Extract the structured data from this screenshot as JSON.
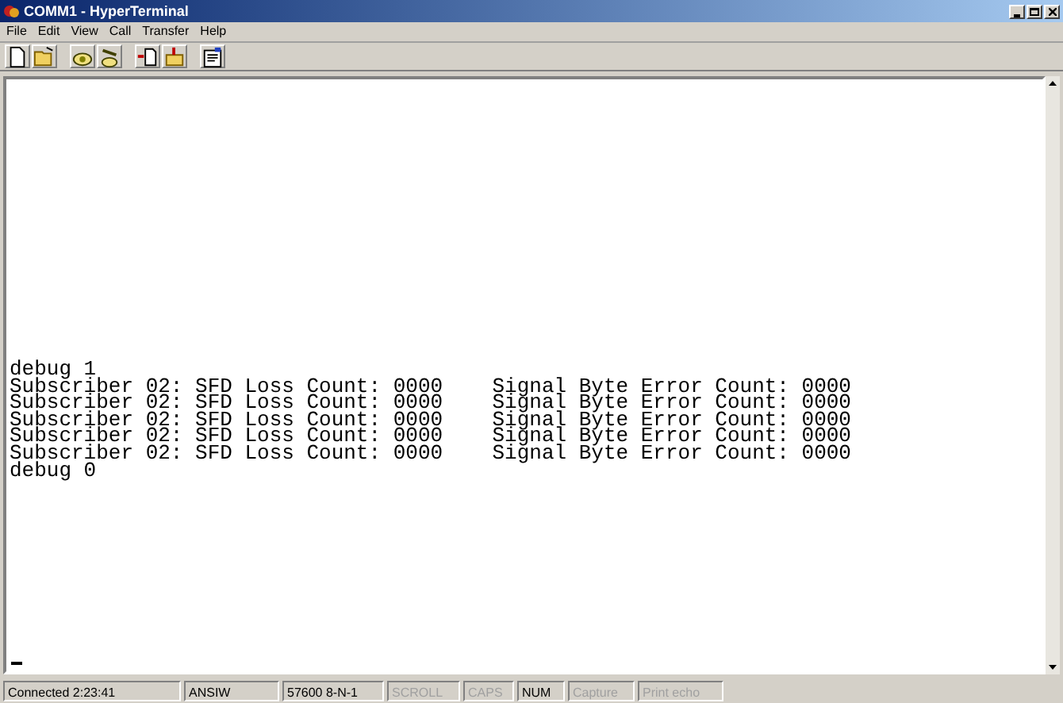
{
  "window": {
    "title": "COMM1 - HyperTerminal"
  },
  "menu": [
    "File",
    "Edit",
    "View",
    "Call",
    "Transfer",
    "Help"
  ],
  "toolbar": [
    {
      "kind": "new"
    },
    {
      "kind": "open"
    },
    {
      "kind": "sep"
    },
    {
      "kind": "call"
    },
    {
      "kind": "hangup"
    },
    {
      "kind": "sep"
    },
    {
      "kind": "send"
    },
    {
      "kind": "receive"
    },
    {
      "kind": "sep"
    },
    {
      "kind": "properties"
    }
  ],
  "terminal": {
    "lines": [
      "debug 1",
      "Subscriber 02: SFD Loss Count: 0000    Signal Byte Error Count: 0000",
      "Subscriber 02: SFD Loss Count: 0000    Signal Byte Error Count: 0000",
      "Subscriber 02: SFD Loss Count: 0000    Signal Byte Error Count: 0000",
      "Subscriber 02: SFD Loss Count: 0000    Signal Byte Error Count: 0000",
      "Subscriber 02: SFD Loss Count: 0000    Signal Byte Error Count: 0000",
      "debug 0"
    ]
  },
  "status_bar": [
    {
      "text": "Connected 2:23:41",
      "disabled": false
    },
    {
      "text": "ANSIW",
      "disabled": false
    },
    {
      "text": "57600 8-N-1",
      "disabled": false
    },
    {
      "text": "SCROLL",
      "disabled": true
    },
    {
      "text": "CAPS",
      "disabled": true
    },
    {
      "text": "NUM",
      "disabled": false
    },
    {
      "text": "Capture",
      "disabled": true
    },
    {
      "text": "Print echo",
      "disabled": true
    }
  ]
}
